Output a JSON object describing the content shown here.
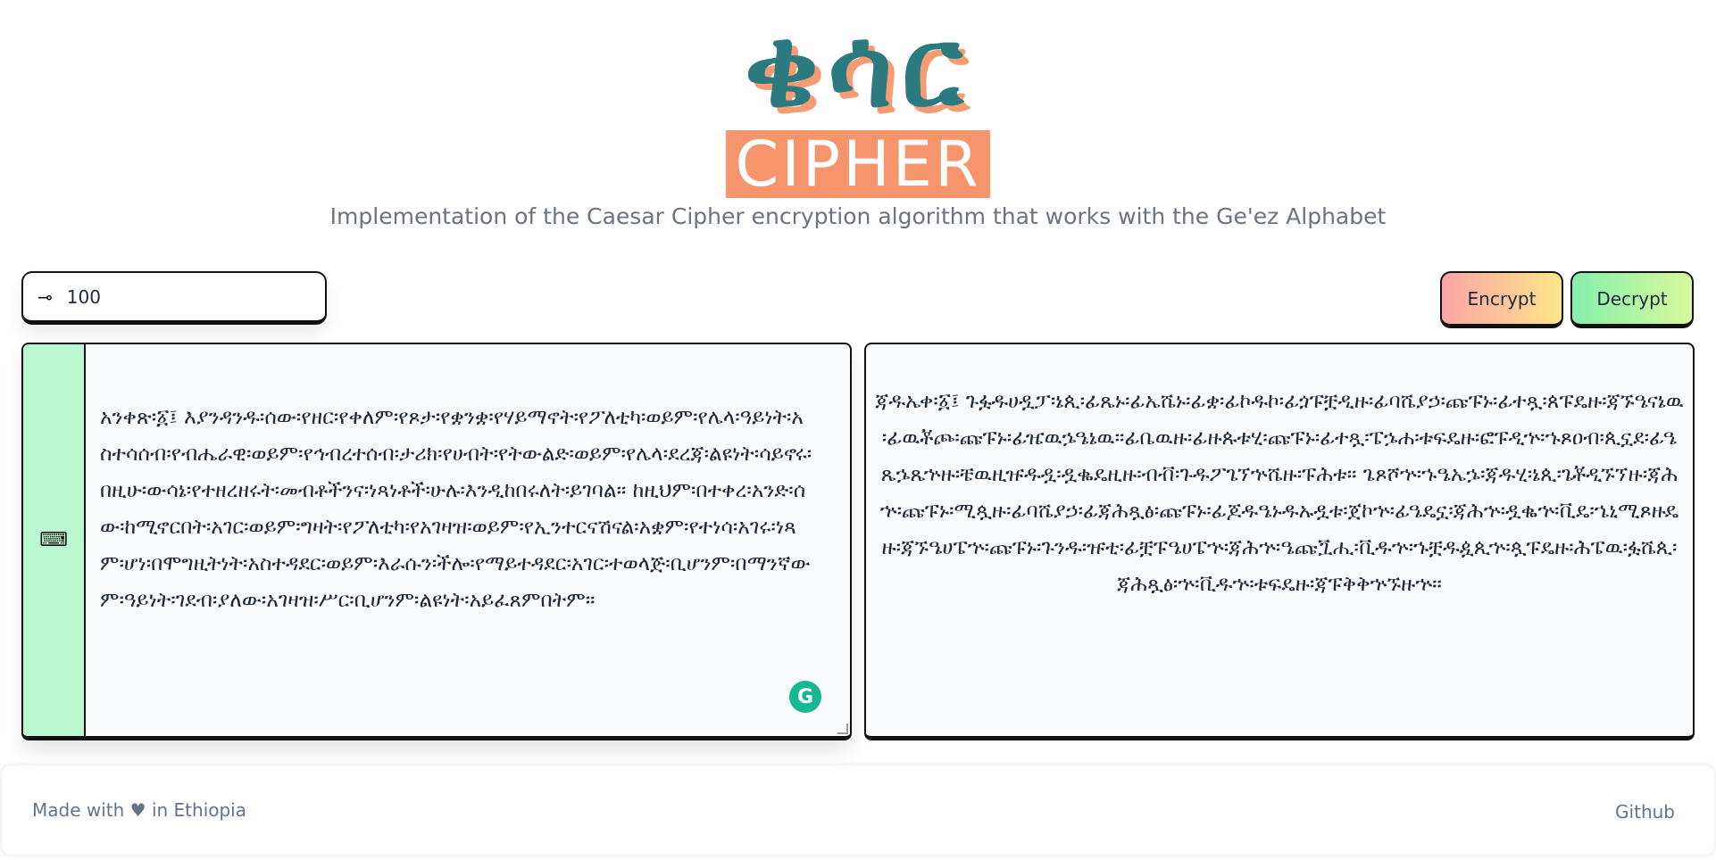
{
  "logo": {
    "geez_text": "ቄሳር",
    "latin_text": "CIPHER"
  },
  "subtitle": "Implementation of the Caesar Cipher encryption algorithm that works with the Ge'ez Alphabet",
  "key": {
    "icon": "key-icon",
    "value": "100"
  },
  "buttons": {
    "encrypt": "Encrypt",
    "decrypt": "Decrypt"
  },
  "input": {
    "keyboard_icon": "keyboard-icon",
    "text": "አንቀጽ፡፩፤ እያንዳንዱ፡ሰው፡የዘር፡የቀለም፡የጾታ፡የቋንቋ፡የሃይማኖት፡የፖለቲካ፡ወይም፡የሌላ፡ዓይነት፡አስተሳሰብ፡የብሔራዊ፡ወይም፡የኅብረተሰብ፡ታሪክ፡የሀብት፡የትውልድ፡ወይም፡የሌላ፡ደረጃ፡ልዩነት፡ሳይኖሩ፡በዚሁ፡ውሳኔ፡የተዘረዘሩት፡መብቶችንና፡ነጻነቶች፡ሁሉ፡እንዲከበሩለት፡ይገባል። ከዚህም፡በተቀረ፡አንድ፡ሰው፡ከሚኖርበት፡አገር፡ወይም፡ግዛት፡የፖለቲካ፡የአገዛዝ፡ወይም፡የኢንተርናሽናል፡አቋም፡የተነሳ፡አገሩ፡ነጻም፡ሆነ፡በሞግዚትነት፡አስተዳደር፡ወይም፡እራሱን፡ችሎ፡የማይተዳደር፡አገር፡ተወላጅ፡ቢሆንም፡በማንኛውም፡ዓይነት፡ገደብ፡ያለው፡አገዛዝ፡ሥር፡ቢሆንም፡ልዩነት፡አይፈጸምበትም።",
    "grammarly_icon": "G"
  },
  "output": {
    "text": "ጃዱኤቀ፡፩፤ ጉፏዱሀዷፓ፡ኔጲ፡ፊጼኑ፡ፊኤሼኑ፡ፊቋ፡ፊኮዱኮ፡ፊጏፑቿዲዙ፡ፊባሼያኃ፡ጩፑኑ፡ፊተጿ፡ጰፑዴዙ፡ጃኙዔናኔዉ፡ፊዉቾጮ፡ጩፑኑ፡ፊዤዉኌዔኔዉ፡፡ፊቤዉዙ፡ፊዙጱቱሂ፡ጩፑኑ፡ፊተጿ፡ፔኌሐ፡ቱፍዴዙ፡ፎፑዲኍ፡ኁጾዐብ፡ጲኗደ፡ፊዔጼኌጼኍዙ፡ቼዉዚዡዱዷ፡ዷቈዴዚዙ፡ብቭ፡ጉዱፖጌኘኍሼዙ፡ፑሕቱ። ጌጾሾኍ፡ኁዔኤኌ፡ጃዱሂ፡ኔጲ፡ጌቾዲኙኘዙ፡ጃሕኍ፡ጩፑኑ፡ሚጷዙ፡ፊባሼያኃ፡ፊጃሕጿፅ፡ጩፑኑ፡ፊጆዱዔኑዱኡዷቱ፡ጀኮኍ፡ፊዔዴኗ፡ጃሕኍ፡ዷቈኍ፡ቪዴ፡ኄኒሚጾዙዴዙ፡ጃኙዔሀፔኍ፡ጩፑኑ፡ጉንዱ፡ዡቲ፡ፊቿፑዔሀፔኍ፡ጃሕኍ፡ዔጩጟሒ፡ቪዱኍ፡ኁቿዱዿጲኍ፡ጷፑዴዙ፡ሕፔዉ፡ፏሼጲ፡ጃሕጿፅ፡ኍ፡ቪዱኍ፡ቱፍዴዙ፡ጃፑቅቅኍኙዙኍ።"
  },
  "footer": {
    "made_with": "Made with ♥ in Ethiopia",
    "github": "Github"
  }
}
